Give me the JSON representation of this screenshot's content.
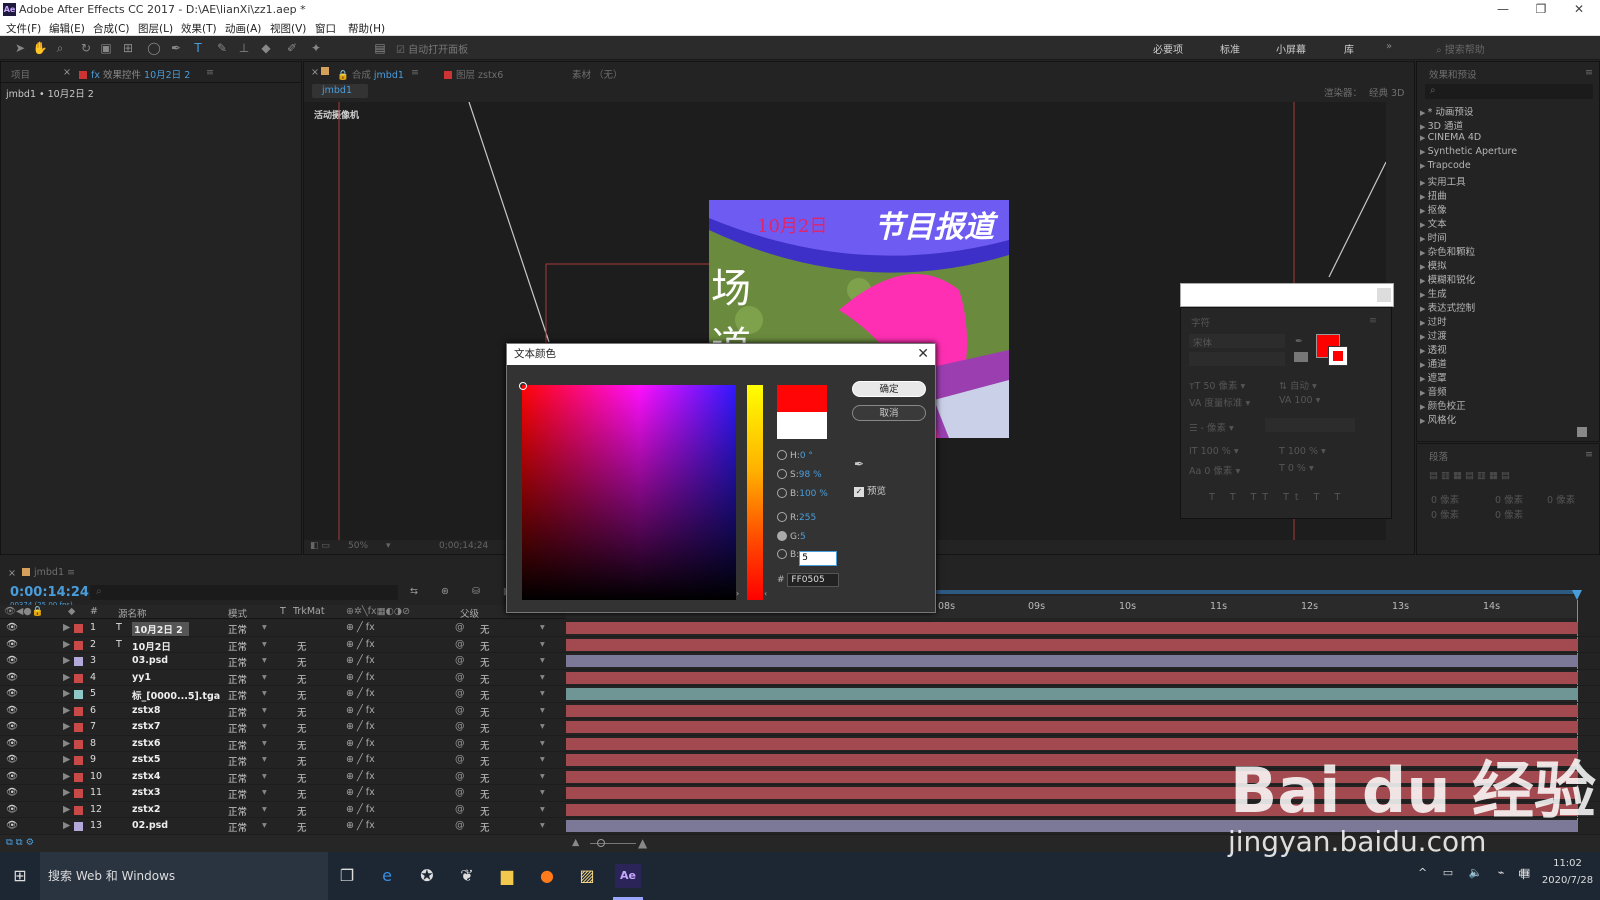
{
  "window": {
    "title": "Adobe After Effects CC 2017 - D:\\AE\\lianXi\\zz1.aep *"
  },
  "menu": [
    "文件(F)",
    "编辑(E)",
    "合成(C)",
    "图层(L)",
    "效果(T)",
    "动画(A)",
    "视图(V)",
    "窗口",
    "帮助(H)"
  ],
  "toolbar": {
    "auto_open": "自动打开面板",
    "workspaces": [
      "必要项",
      "标准",
      "小屏幕",
      "库"
    ],
    "search_help": "搜索帮助"
  },
  "project_panel": {
    "tab_project": "项目",
    "tab_effect_controls": "效果控件",
    "tab_effect_target": "10月2日 2",
    "breadcrumb": "jmbd1 • 10月2日 2"
  },
  "comp_panel": {
    "tab_comp": "合成",
    "tab_comp_name": "jmbd1",
    "tab_layer": "图层 zstx6",
    "tab_footage": "素材 （无）",
    "crumb": "jmbd1",
    "renderer": "渲染器：",
    "renderer_val": "经典 3D",
    "camera": "活动摄像机",
    "img_date": "10月2日",
    "img_headline": "节目报道",
    "img_side": "场道",
    "zoom": "50%",
    "timecode": "0;00;14;24"
  },
  "effects_panel": {
    "title": "效果和预设",
    "items": [
      "* 动画预设",
      "3D 通道",
      "CINEMA 4D",
      "Synthetic Aperture",
      "Trapcode",
      "实用工具",
      "扭曲",
      "抠像",
      "文本",
      "时间",
      "杂色和颗粒",
      "模拟",
      "模糊和锐化",
      "生成",
      "表达式控制",
      "过时",
      "过渡",
      "透视",
      "通道",
      "遮罩",
      "音频",
      "颜色校正",
      "风格化"
    ],
    "para_title": "段落",
    "para_values": [
      "0 像素",
      "0 像素",
      "0 像素",
      "0 像素",
      "0 像素"
    ]
  },
  "character_panel": {
    "title": "字符",
    "font": "宋体",
    "size": "50 像素",
    "leading": "自动",
    "kerning": "度量标准",
    "tracking": "100",
    "stroke": "- 像素",
    "vscale": "100 %",
    "hscale": "100 %",
    "baseline": "0 像素",
    "tsume": "0 %",
    "fill_color": "#ff0000"
  },
  "color_dialog": {
    "title": "文本颜色",
    "ok": "确定",
    "cancel": "取消",
    "h_label": "H:",
    "h": "0 °",
    "s_label": "S:",
    "s": "98 %",
    "b_label": "B:",
    "b": "100 %",
    "r_label": "R:",
    "r": "255",
    "g_label": "G:",
    "g": "5",
    "bb_label": "B:",
    "bb": "5",
    "hex_label": "#",
    "hex": "FF0505",
    "preview": "预览",
    "new_color": "#ff0505",
    "old_color": "#ffffff"
  },
  "timeline": {
    "tab": "jmbd1",
    "timecode": "0:00:14:24",
    "frames": "00374 (25.00 fps)",
    "col_num": "#",
    "col_name": "源名称",
    "col_mode": "模式",
    "col_t": "T",
    "col_trkmat": "TrkMat",
    "col_parent": "父级",
    "ruler": [
      "08s",
      "09s",
      "10s",
      "11s",
      "12s",
      "13s",
      "14s"
    ],
    "layers": [
      {
        "num": "1",
        "type": "T",
        "name": "10月2日 2",
        "mode": "正常",
        "trk": "",
        "parent": "无",
        "label": "#c94848",
        "bar": "#a24a4f"
      },
      {
        "num": "2",
        "type": "T",
        "name": "10月2日",
        "mode": "正常",
        "trk": "无",
        "parent": "无",
        "label": "#c94848",
        "bar": "#a24a4f"
      },
      {
        "num": "3",
        "type": "",
        "name": "03.psd",
        "mode": "正常",
        "trk": "无",
        "parent": "无",
        "label": "#b3a8d9",
        "bar": "#7c7898"
      },
      {
        "num": "4",
        "type": "",
        "name": "yy1",
        "mode": "正常",
        "trk": "无",
        "parent": "无",
        "label": "#c94848",
        "bar": "#a24a4f"
      },
      {
        "num": "5",
        "type": "",
        "name": "标_[0000...5].tga",
        "mode": "正常",
        "trk": "无",
        "parent": "无",
        "label": "#8fc7c7",
        "bar": "#6f9595"
      },
      {
        "num": "6",
        "type": "",
        "name": "zstx8",
        "mode": "正常",
        "trk": "无",
        "parent": "无",
        "label": "#c94848",
        "bar": "#a24a4f"
      },
      {
        "num": "7",
        "type": "",
        "name": "zstx7",
        "mode": "正常",
        "trk": "无",
        "parent": "无",
        "label": "#c94848",
        "bar": "#a24a4f"
      },
      {
        "num": "8",
        "type": "",
        "name": "zstx6",
        "mode": "正常",
        "trk": "无",
        "parent": "无",
        "label": "#c94848",
        "bar": "#a24a4f"
      },
      {
        "num": "9",
        "type": "",
        "name": "zstx5",
        "mode": "正常",
        "trk": "无",
        "parent": "无",
        "label": "#c94848",
        "bar": "#a24a4f"
      },
      {
        "num": "10",
        "type": "",
        "name": "zstx4",
        "mode": "正常",
        "trk": "无",
        "parent": "无",
        "label": "#c94848",
        "bar": "#a24a4f"
      },
      {
        "num": "11",
        "type": "",
        "name": "zstx3",
        "mode": "正常",
        "trk": "无",
        "parent": "无",
        "label": "#c94848",
        "bar": "#a24a4f"
      },
      {
        "num": "12",
        "type": "",
        "name": "zstx2",
        "mode": "正常",
        "trk": "无",
        "parent": "无",
        "label": "#c94848",
        "bar": "#a24a4f"
      },
      {
        "num": "13",
        "type": "",
        "name": "02.psd",
        "mode": "正常",
        "trk": "无",
        "parent": "无",
        "label": "#b3a8d9",
        "bar": "#7c7898"
      }
    ]
  },
  "taskbar": {
    "search": "搜索 Web 和 Windows",
    "time": "11:02",
    "date": "2020/7/28",
    "ime": "中"
  },
  "watermark": {
    "brand": "Bai du 经验",
    "url": "jingyan.baidu.com"
  }
}
